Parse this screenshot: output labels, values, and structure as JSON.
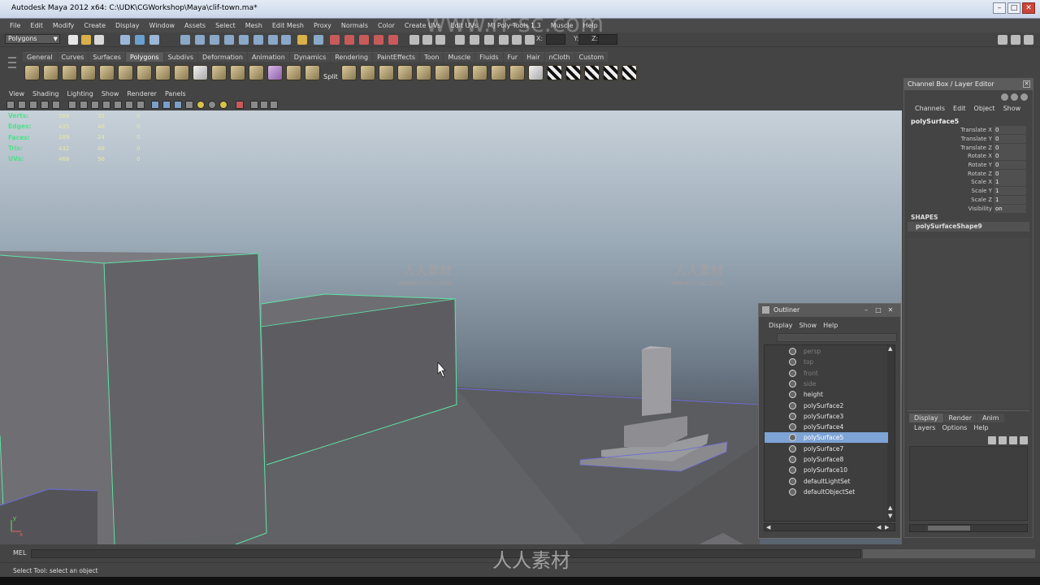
{
  "window": {
    "title": "Autodesk Maya 2012 x64: C:\\UDK\\CGWorkshop\\Maya\\clif-town.ma*"
  },
  "menus": [
    "File",
    "Edit",
    "Modify",
    "Create",
    "Display",
    "Window",
    "Assets",
    "Select",
    "Mesh",
    "Edit Mesh",
    "Proxy",
    "Normals",
    "Color",
    "Create UVs",
    "Edit UVs",
    "MJ Poly Tools 1.3",
    "Muscle",
    "Help"
  ],
  "status_line": {
    "mode": "Polygons",
    "x_label": "X:",
    "y_label": "Y:",
    "z_label": "Z:"
  },
  "shelf": {
    "tabs": [
      "General",
      "Curves",
      "Surfaces",
      "Polygons",
      "Subdivs",
      "Deformation",
      "Animation",
      "Dynamics",
      "Rendering",
      "PaintEffects",
      "Toon",
      "Muscle",
      "Fluids",
      "Fur",
      "Hair",
      "nCloth",
      "Custom"
    ],
    "active_tab": "Polygons",
    "split_label": "Split"
  },
  "panel_menus": [
    "View",
    "Shading",
    "Lighting",
    "Show",
    "Renderer",
    "Panels"
  ],
  "hud": [
    {
      "label": "Verts:",
      "total": "284",
      "selected": "32",
      "components": "0"
    },
    {
      "label": "Edges:",
      "total": "435",
      "selected": "48",
      "components": "0"
    },
    {
      "label": "Faces:",
      "total": "189",
      "selected": "24",
      "components": "0"
    },
    {
      "label": "Tris:",
      "total": "432",
      "selected": "48",
      "components": "0"
    },
    {
      "label": "UVs:",
      "total": "468",
      "selected": "56",
      "components": "0"
    }
  ],
  "channel_box": {
    "title": "Channel Box / Layer Editor",
    "menus": [
      "Channels",
      "Edit",
      "Object",
      "Show"
    ],
    "object_name": "polySurface5",
    "attributes": [
      {
        "name": "Translate X",
        "value": "0"
      },
      {
        "name": "Translate Y",
        "value": "0"
      },
      {
        "name": "Translate Z",
        "value": "0"
      },
      {
        "name": "Rotate X",
        "value": "0"
      },
      {
        "name": "Rotate Y",
        "value": "0"
      },
      {
        "name": "Rotate Z",
        "value": "0"
      },
      {
        "name": "Scale X",
        "value": "1"
      },
      {
        "name": "Scale Y",
        "value": "1"
      },
      {
        "name": "Scale Z",
        "value": "1"
      },
      {
        "name": "Visibility",
        "value": "on"
      }
    ],
    "shapes_header": "SHAPES",
    "shape_name": "polySurfaceShape9",
    "layer_tabs": [
      "Display",
      "Render",
      "Anim"
    ],
    "layer_menus": [
      "Layers",
      "Options",
      "Help"
    ]
  },
  "outliner": {
    "title": "Outliner",
    "menus": [
      "Display",
      "Show",
      "Help"
    ],
    "items": [
      {
        "name": "persp",
        "state": "dim"
      },
      {
        "name": "top",
        "state": "dim"
      },
      {
        "name": "front",
        "state": "dim"
      },
      {
        "name": "side",
        "state": "dim"
      },
      {
        "name": "height",
        "state": "normal"
      },
      {
        "name": "polySurface2",
        "state": "normal"
      },
      {
        "name": "polySurface3",
        "state": "normal"
      },
      {
        "name": "polySurface4",
        "state": "normal"
      },
      {
        "name": "polySurface5",
        "state": "selected"
      },
      {
        "name": "polySurface7",
        "state": "normal"
      },
      {
        "name": "polySurface8",
        "state": "normal"
      },
      {
        "name": "polySurface10",
        "state": "normal"
      },
      {
        "name": "defaultLightSet",
        "state": "normal"
      },
      {
        "name": "defaultObjectSet",
        "state": "normal"
      }
    ]
  },
  "command_line": {
    "label": "MEL"
  },
  "help_line": {
    "text": "Select Tool: select an object"
  },
  "axis": {
    "y": "y",
    "x": "x"
  },
  "watermarks": {
    "site": "www.rr-sc.com",
    "cn": "人人素材",
    "small_site": "www.rr-sc.com"
  },
  "colors": {
    "selection_highlight": "#7ea4d6",
    "hud_label": "#4fe08a",
    "selected_wire": "#5fe3a5"
  }
}
